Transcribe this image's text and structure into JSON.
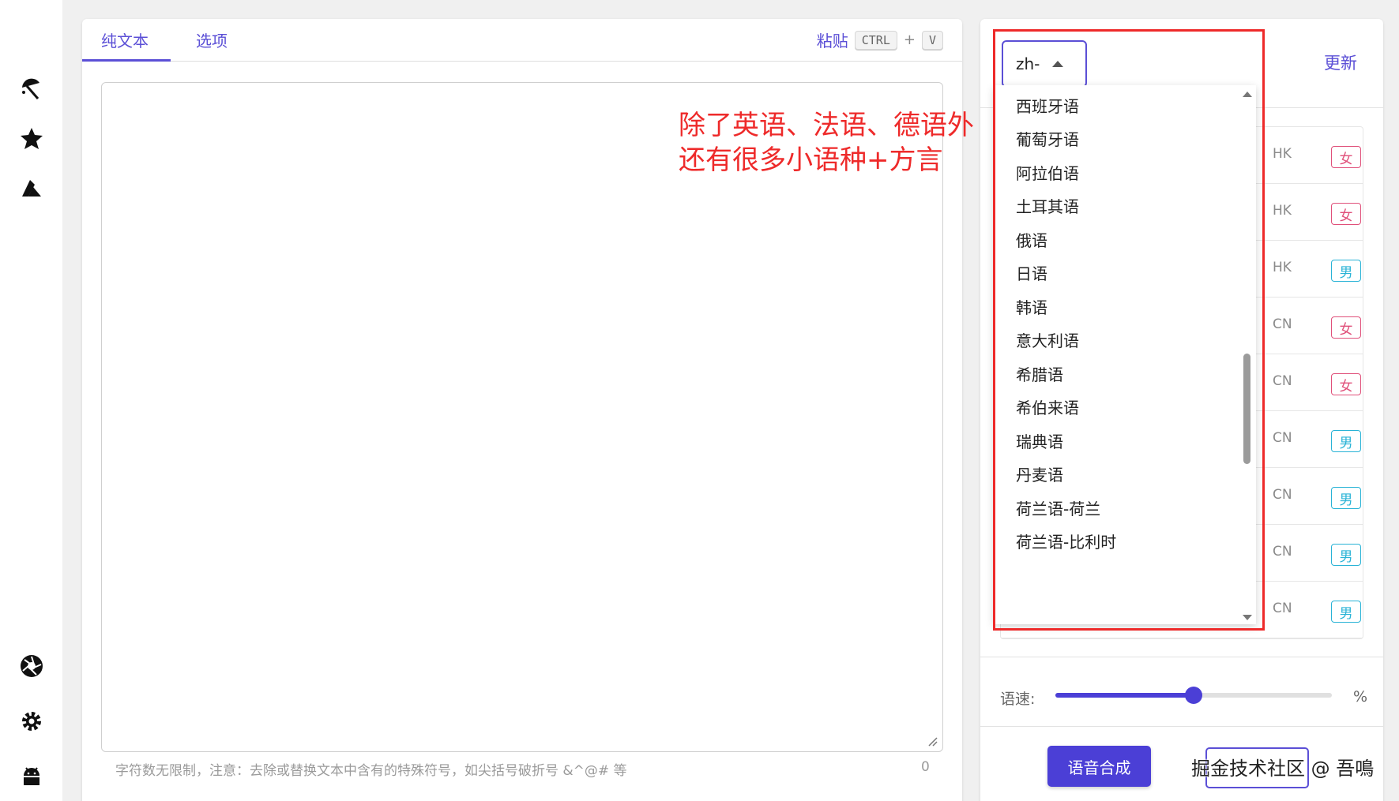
{
  "colors": {
    "accent": "#5b4fd6",
    "annotation": "#ee2a2a",
    "female": "#e0507a",
    "male": "#29b3d6"
  },
  "sidebar": {
    "icons": [
      "umbrella-icon",
      "star-icon",
      "azure-icon",
      "aperture-icon",
      "gear-icon",
      "android-icon"
    ]
  },
  "editor": {
    "tabs": [
      {
        "label": "纯文本"
      },
      {
        "label": "选项"
      }
    ],
    "paste_label": "粘贴",
    "shortcut": {
      "key1": "CTRL",
      "plus": "+",
      "key2": "V"
    },
    "annotation_line1": "除了英语、法语、德语外",
    "annotation_line2": "还有很多小语种+方言",
    "hint": "字符数无限制，注意：去除或替换文本中含有的特殊符号，如尖括号破折号 &^@# 等",
    "char_count": "0"
  },
  "voice": {
    "language_value": "zh-",
    "refresh_label": "更新",
    "rows": [
      {
        "code": "HK",
        "gender": "女",
        "type": "f"
      },
      {
        "code": "HK",
        "gender": "女",
        "type": "f"
      },
      {
        "code": "HK",
        "gender": "男",
        "type": "m"
      },
      {
        "code": "CN",
        "gender": "女",
        "type": "f"
      },
      {
        "code": "CN",
        "gender": "女",
        "type": "f"
      },
      {
        "code": "CN",
        "gender": "男",
        "type": "m"
      },
      {
        "code": "CN",
        "gender": "男",
        "type": "m"
      },
      {
        "code": "CN",
        "gender": "男",
        "type": "m"
      },
      {
        "code": "CN",
        "gender": "男",
        "type": "m"
      }
    ],
    "speed_label": "语速:",
    "speed_value": 0.5,
    "percent_sign": "%",
    "synth_button": "语音合成"
  },
  "dropdown": {
    "options": [
      "西班牙语",
      "葡萄牙语",
      "阿拉伯语",
      "土耳其语",
      "俄语",
      "日语",
      "韩语",
      "意大利语",
      "希腊语",
      "希伯来语",
      "瑞典语",
      "丹麦语",
      "荷兰语-荷兰",
      "荷兰语-比利时"
    ]
  },
  "watermark": "掘金技术社区 @ 吾鳴"
}
